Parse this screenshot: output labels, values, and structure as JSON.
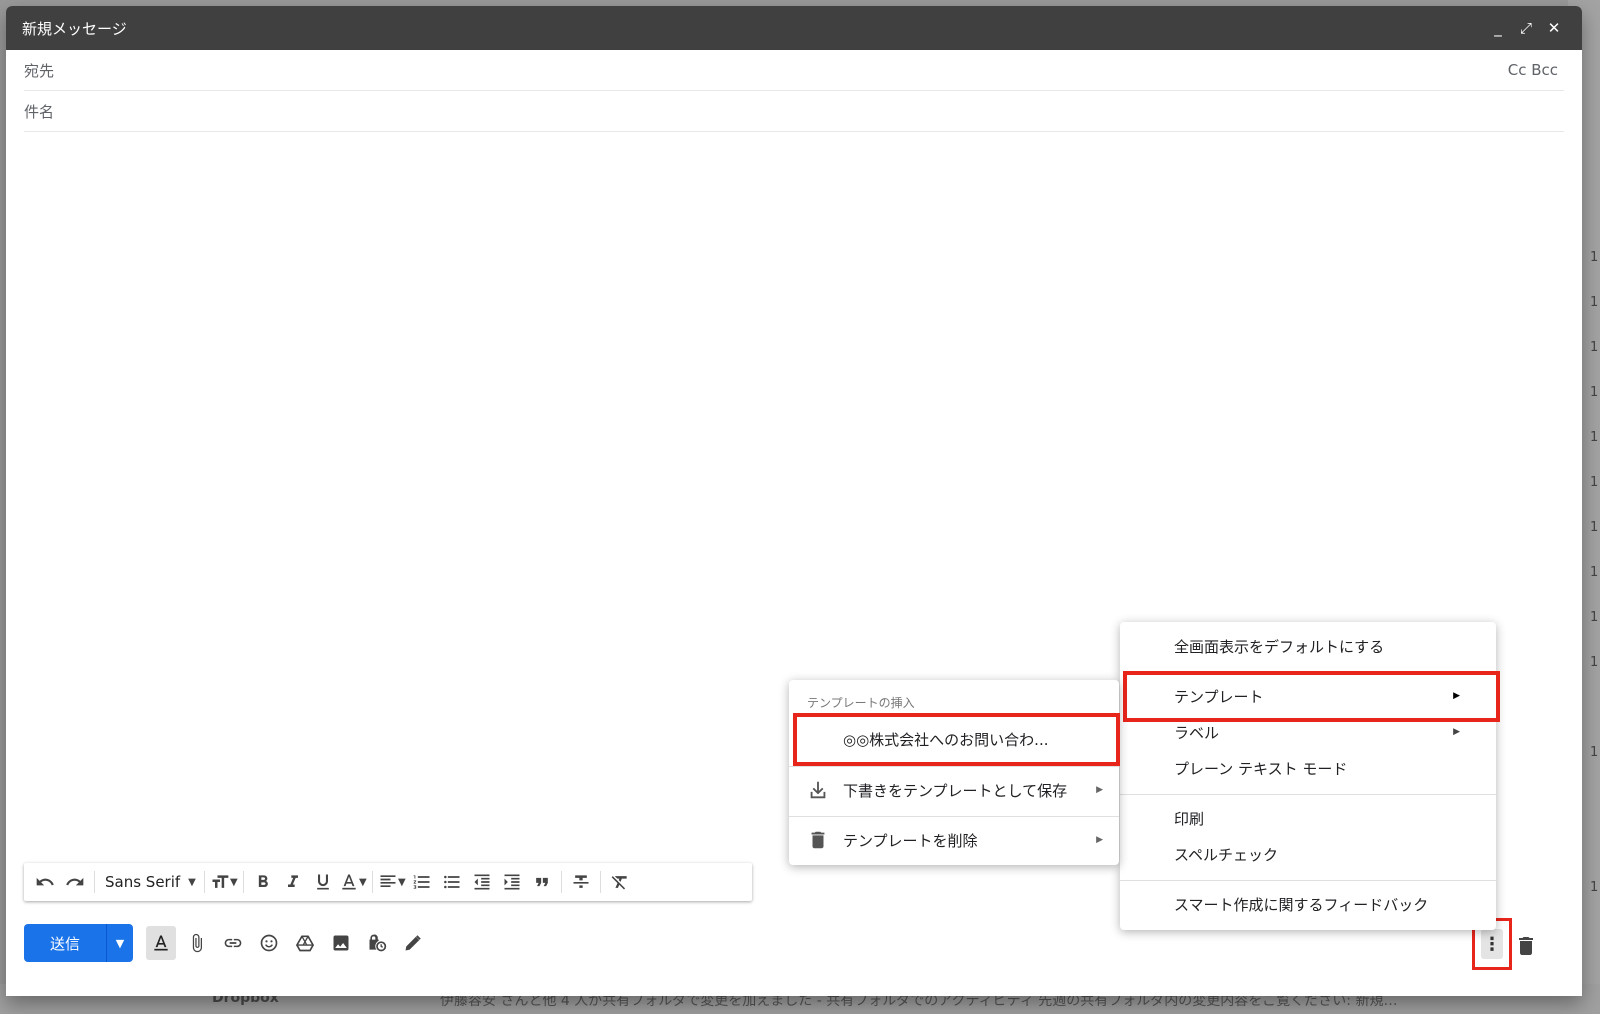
{
  "backdrop": {
    "right_ticks": [
      "1",
      "1",
      "1",
      "1",
      "1",
      "1",
      "1",
      "1",
      "1",
      "1",
      "1",
      "1"
    ],
    "bottom_sender": "Dropbox",
    "bottom_snippet": "伊藤容安 さんと他 4 人が共有フォルダで変更を加えました - 共有フォルダでのアクティビティ 先週の共有フォルダ内の変更内容をご覧ください: 新規…"
  },
  "compose": {
    "title": "新規メッセージ",
    "window_buttons": {
      "minimize": "_",
      "fullscreen": "⤢",
      "close": "✕"
    },
    "to_label": "宛先",
    "cc_bcc": "Cc Bcc",
    "subject_label": "件名"
  },
  "toolbar": {
    "font": "Sans Serif",
    "send_label": "送信"
  },
  "main_menu": {
    "items": [
      {
        "label": "全画面表示をデフォルトにする",
        "has_submenu": false
      },
      {
        "label": "テンプレート",
        "has_submenu": true,
        "highlighted": true
      },
      {
        "label": "ラベル",
        "has_submenu": true
      },
      {
        "label": "プレーン テキスト モード",
        "has_submenu": false
      },
      {
        "label": "印刷",
        "has_submenu": false
      },
      {
        "label": "スペルチェック",
        "has_submenu": false
      },
      {
        "label": "スマート作成に関するフィードバック",
        "has_submenu": false
      }
    ]
  },
  "template_menu": {
    "header": "テンプレートの挿入",
    "items": [
      {
        "label": "◎◎株式会社へのお問い合わ...",
        "icon": "none",
        "highlighted": true
      },
      {
        "label": "下書きをテンプレートとして保存",
        "icon": "download-icon",
        "has_submenu": true
      },
      {
        "label": "テンプレートを削除",
        "icon": "trash-icon",
        "has_submenu": true
      }
    ]
  },
  "colors": {
    "accent": "#1a73e8",
    "titlebar": "#404040",
    "highlight": "#e8251b"
  }
}
